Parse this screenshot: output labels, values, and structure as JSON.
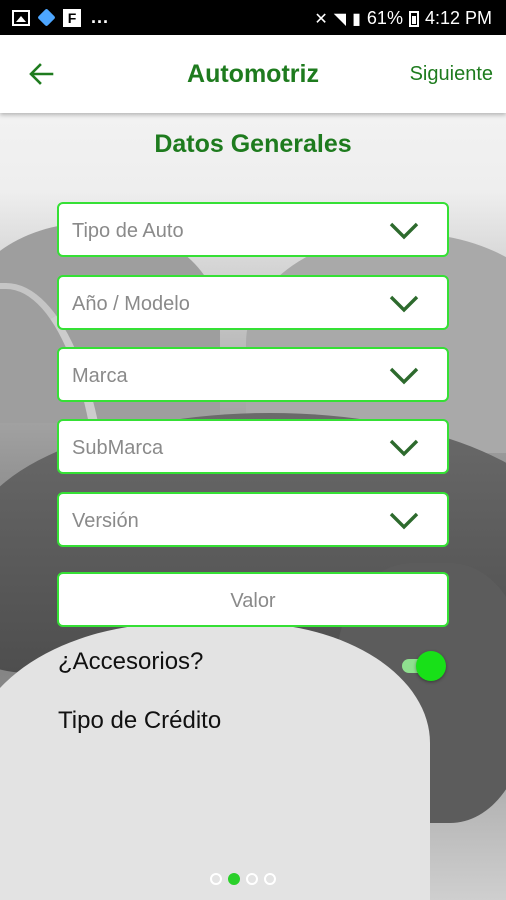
{
  "status_bar": {
    "battery": "61%",
    "time": "4:12 PM",
    "more": "..."
  },
  "app_bar": {
    "title": "Automotriz",
    "next_label": "Siguiente"
  },
  "form": {
    "section_title": "Datos Generales",
    "fields": [
      {
        "label": "Tipo de Auto"
      },
      {
        "label": "Año / Modelo"
      },
      {
        "label": "Marca"
      },
      {
        "label": "SubMarca"
      },
      {
        "label": "Versión"
      }
    ],
    "value_placeholder": "Valor",
    "accessories_label": "¿Accesorios?",
    "accessories_on": true,
    "credit_type_label": "Tipo de Crédito"
  },
  "pager": {
    "pages": 4,
    "active_index": 1
  },
  "colors": {
    "accent": "#1e7b1e",
    "field_border": "#35e035",
    "toggle": "#18e018"
  }
}
